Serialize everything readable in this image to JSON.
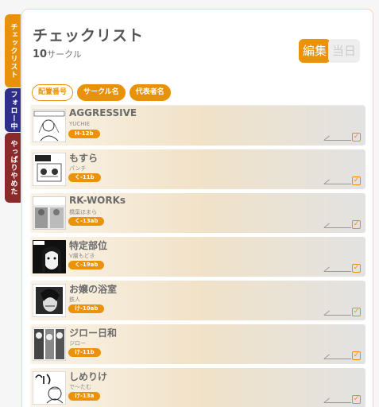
{
  "side_tabs": [
    {
      "label": "チェックリスト",
      "color": "#e8920c"
    },
    {
      "label": "フォロー中",
      "color": "#2f2e8a"
    },
    {
      "label": "やっぱりやめた",
      "color": "#8a2a2a"
    }
  ],
  "header": {
    "title": "チェックリスト",
    "count_number": "10",
    "count_unit": "サークル"
  },
  "mode_toggle": {
    "active": "編集",
    "inactive": "当日"
  },
  "sort_buttons": [
    {
      "label": "配置番号",
      "selected": false
    },
    {
      "label": "サークル名",
      "selected": true
    },
    {
      "label": "代表者名",
      "selected": true
    }
  ],
  "circles": [
    {
      "name": "AGGRESSIVE",
      "representative": "YUCHIE",
      "space": "H-12b"
    },
    {
      "name": "もすら",
      "representative": "パンチ",
      "space": "く-11b"
    },
    {
      "name": "RK-WORKs",
      "representative": "橋葉ほまら",
      "space": "く-13ab"
    },
    {
      "name": "特定部位",
      "representative": "V層もどき",
      "space": "く-19ab"
    },
    {
      "name": "お嬢の浴室",
      "representative": "鉄人",
      "space": "け-10ab"
    },
    {
      "name": "ジロー日和",
      "representative": "ジロー",
      "space": "け-11b"
    },
    {
      "name": "しめりけ",
      "representative": "で〜たむ",
      "space": "け-13a"
    }
  ],
  "colors": {
    "accent": "#eb920b",
    "text": "#555555"
  },
  "icons": {
    "memo": "pencil-line-icon",
    "check": "checkbox-icon"
  }
}
